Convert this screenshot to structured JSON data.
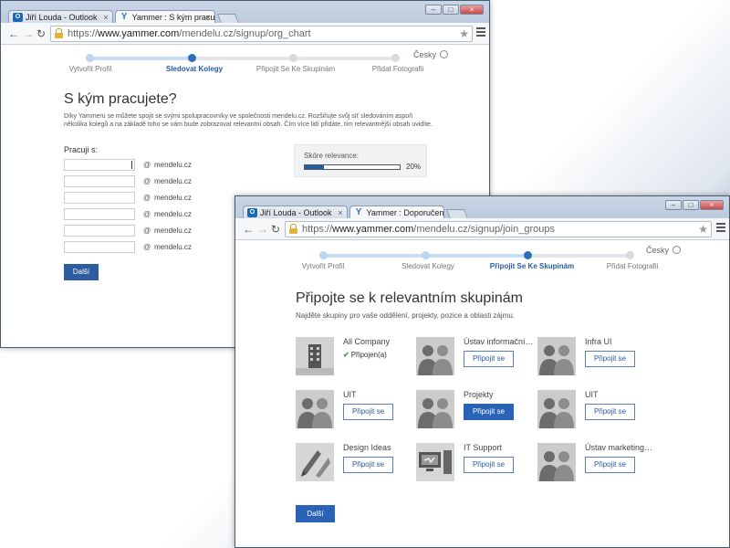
{
  "colors": {
    "accent": "#2a63b5",
    "step_current": "#2a6fb8"
  },
  "icons": [
    "outlook-icon",
    "yammer-icon",
    "lock-icon",
    "star-icon",
    "menu-icon",
    "globe-icon",
    "checkmark-icon",
    "building-icon",
    "people-icon",
    "tools-icon",
    "computer-icon"
  ],
  "win1": {
    "tabs": [
      {
        "label": "Jiří Louda - Outlook",
        "icon": "outlook-icon"
      },
      {
        "label": "Yammer : S kým pracujete",
        "icon": "yammer-icon"
      }
    ],
    "url_scheme": "https://",
    "url_host": "www.yammer.com",
    "url_path": "/mendelu.cz/signup/org_chart",
    "lang": "Česky",
    "steps": [
      "Vytvořit Profil",
      "Sledovat Kolegy",
      "Připojit Se Ke Skupinám",
      "Přidat Fotografii"
    ],
    "current_step": 1,
    "title": "S kým pracujete?",
    "desc_line1": "Díky Yammeru se můžete spojit se svými spolupracovníky ve společnosti mendelu.cz. Rozšiřujte svůj síť sledováním aspoň",
    "desc_line2": "několika kolegů a na základě toho se vám bude zobrazovat relevantní obsah. Čím více lidí přidáte, tím relevantnější obsah uvidíte.",
    "field_label": "Pracuji s:",
    "domain": "mendelu.cz",
    "at_sign": "@",
    "next_label": "Další",
    "relevance_label": "Skóre relevance:",
    "relevance_value": 0.2,
    "relevance_text": "20%"
  },
  "win2": {
    "tabs": [
      {
        "label": "Jiří Louda - Outlook",
        "icon": "outlook-icon"
      },
      {
        "label": "Yammer : Doporučení sku",
        "icon": "yammer-icon"
      }
    ],
    "url_scheme": "https://",
    "url_host": "www.yammer.com",
    "url_path": "/mendelu.cz/signup/join_groups",
    "lang": "Česky",
    "steps": [
      "Vytvořit Profil",
      "Sledovat Kolegy",
      "Připojit Se Ke Skupinám",
      "Přidat Fotografii"
    ],
    "current_step": 2,
    "title": "Připojte se k relevantním skupinám",
    "desc": "Najděte skupiny pro vaše oddělení, projekty, pozice a oblasti zájmu.",
    "join_label": "Připojit se",
    "joined_label": "Připojen(a)",
    "groups": [
      {
        "name": "All Company",
        "image": "building-icon",
        "joined": true
      },
      {
        "name": "Ústav informačníc...",
        "image": "people-icon"
      },
      {
        "name": "Infra UI",
        "image": "people-icon"
      },
      {
        "name": "UIT",
        "image": "people-icon"
      },
      {
        "name": "Projekty",
        "image": "people-icon",
        "active": true
      },
      {
        "name": "UIT",
        "image": "people-icon"
      },
      {
        "name": "Design Ideas",
        "image": "tools-icon"
      },
      {
        "name": "IT Support",
        "image": "computer-icon"
      },
      {
        "name": "Ústav marketingu ...",
        "image": "people-icon"
      }
    ],
    "next_label": "Další"
  }
}
